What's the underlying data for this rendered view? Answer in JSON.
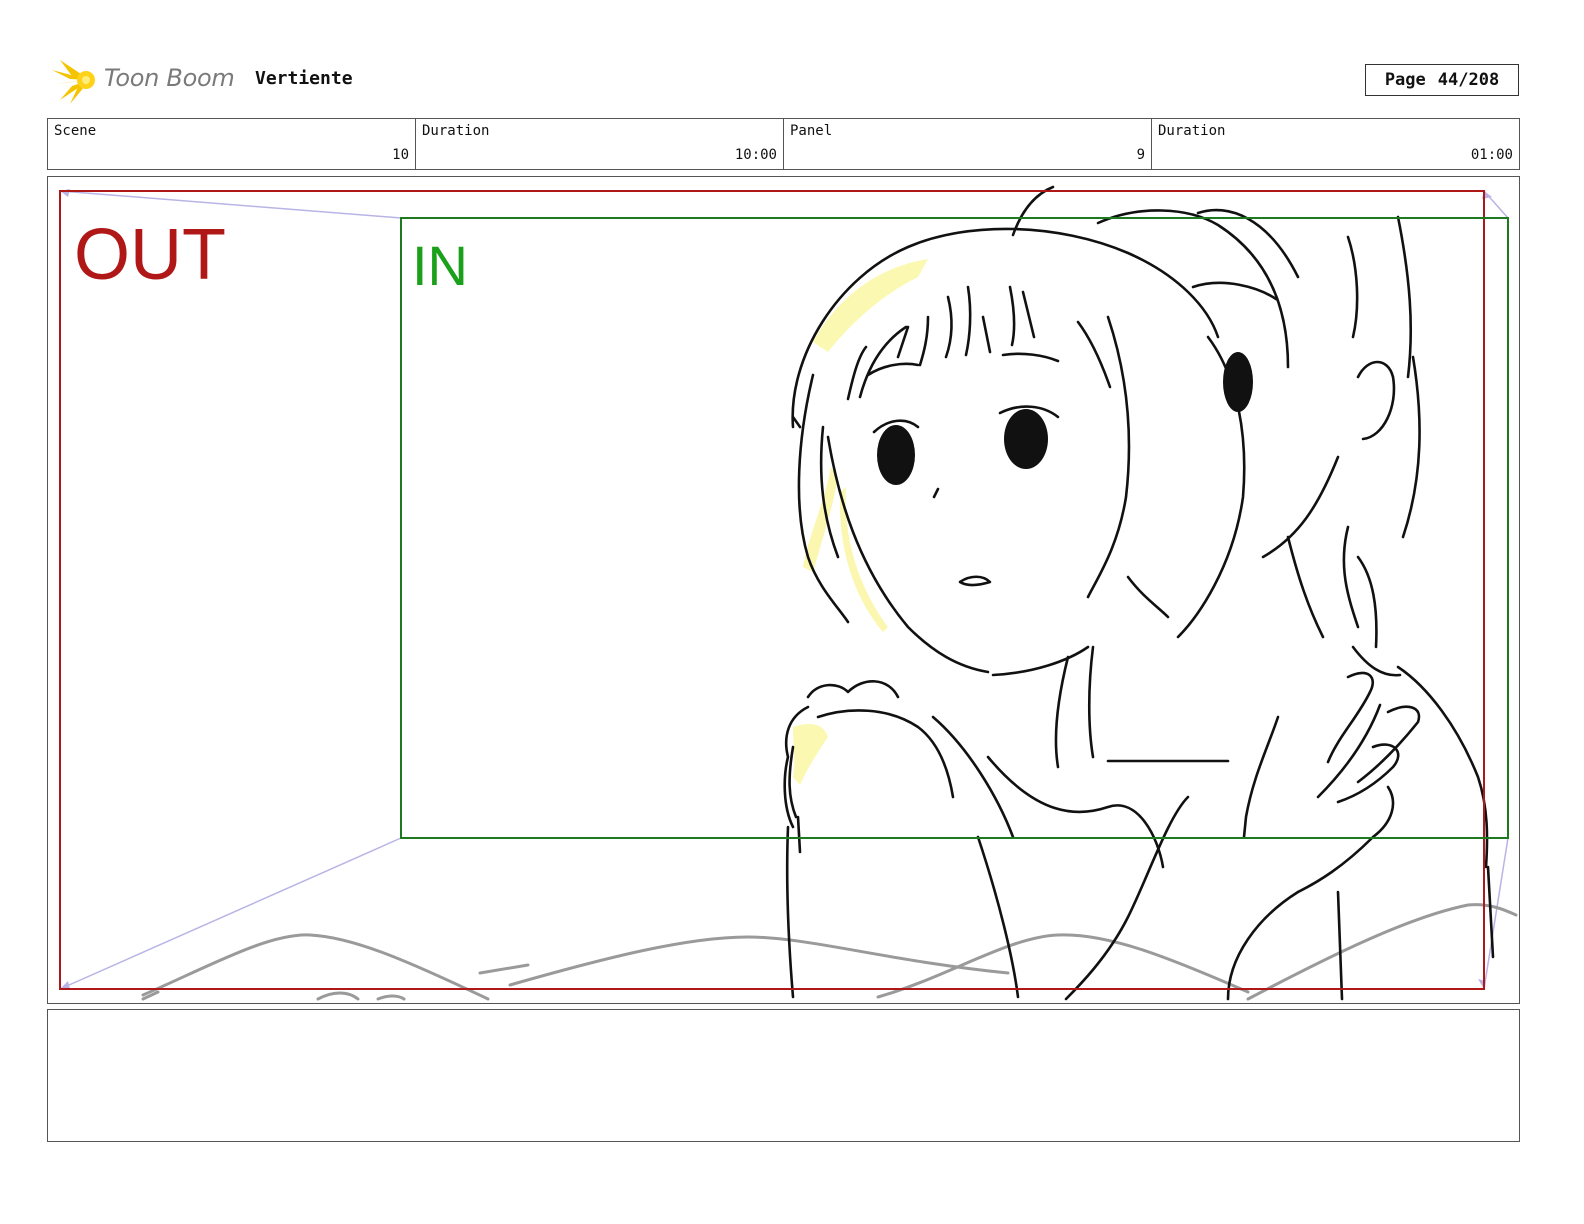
{
  "header": {
    "logo_text": "Toon Boom",
    "project_title": "Vertiente",
    "page_label": "Page",
    "page_value": "44/208"
  },
  "info": {
    "scene_label": "Scene",
    "scene_value": "10",
    "scene_duration_label": "Duration",
    "scene_duration_value": "10:00",
    "panel_label": "Panel",
    "panel_value": "9",
    "panel_duration_label": "Duration",
    "panel_duration_value": "01:00"
  },
  "panel": {
    "out_label": "OUT",
    "in_label": "IN",
    "colors": {
      "out_frame": "#b01818",
      "in_frame": "#1e7a1e",
      "in_text": "#1aa01a",
      "camera_path": "#b8b4e6",
      "highlight": "#fbf7a8"
    }
  },
  "notes": {
    "text": ""
  }
}
